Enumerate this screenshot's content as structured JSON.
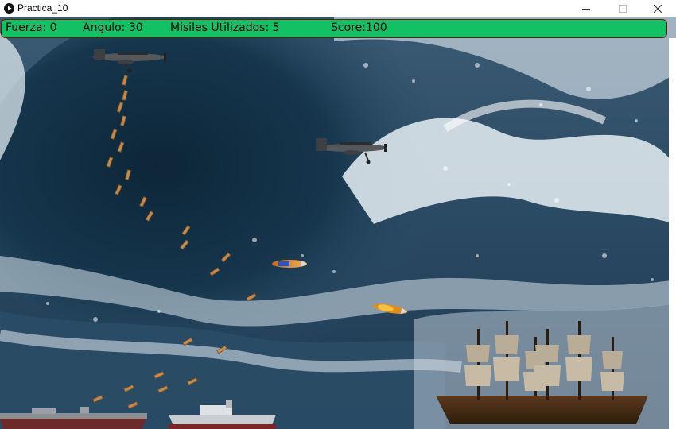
{
  "window": {
    "title": "Practica_10",
    "controls": {
      "minimize": "—",
      "maximize": "☐",
      "close": "✕"
    }
  },
  "hud": {
    "fuerza": "Fuerza: 0",
    "angulo": "Angulo: 30",
    "misiles": "Misiles Utilizados: 5",
    "score": "Score:100",
    "bar_color": "#13c064"
  },
  "scene": {
    "background": "stormy-ocean-wave",
    "colors": {
      "sky": "#2c4c66",
      "wave_dark": "#0f2c42",
      "foam": "#dfe9ef"
    },
    "sprites": [
      "bomber-plane-icon",
      "bomber-plane-icon",
      "missile-icon",
      "warship-icon",
      "pirate-ship-icon",
      "bomb-icon"
    ]
  }
}
